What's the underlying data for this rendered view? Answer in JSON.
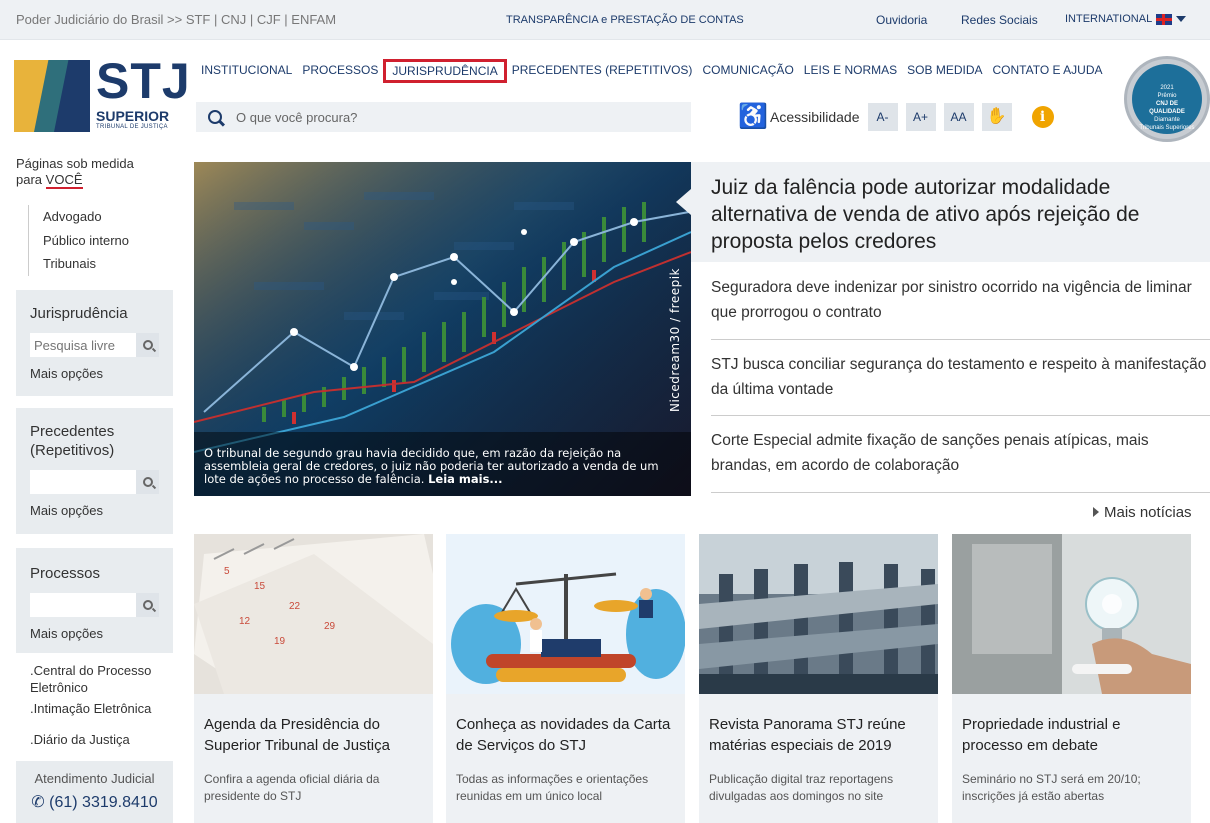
{
  "topbar": {
    "portal_links": "Poder Judiciário do Brasil >> STF | CNJ | CJF | ENFAM",
    "transparency": "TRANSPARÊNCIA e PRESTAÇÃO DE CONTAS",
    "ouvidoria": "Ouvidoria",
    "redes": "Redes Sociais",
    "international": "INTERNATIONAL"
  },
  "logo": {
    "stj": "STJ",
    "superior": "SUPERIOR",
    "tribunal": "TRIBUNAL DE JUSTIÇA"
  },
  "nav": [
    {
      "label": "INSTITUCIONAL"
    },
    {
      "label": "PROCESSOS"
    },
    {
      "label": "JURISPRUDÊNCIA",
      "active": true
    },
    {
      "label": "PRECEDENTES (REPETITIVOS)"
    },
    {
      "label": "COMUNICAÇÃO"
    },
    {
      "label": "LEIS E NORMAS"
    },
    {
      "label": "SOB MEDIDA"
    },
    {
      "label": "CONTATO E AJUDA"
    }
  ],
  "search": {
    "placeholder": "O que você procura?"
  },
  "accessibility": {
    "label": "Acessibilidade",
    "a_minus": "A-",
    "a_plus": "A+",
    "aa": "AA",
    "info": "i"
  },
  "seal": {
    "year": "2021",
    "line1": "Prêmio",
    "line2": "CNJ DE",
    "line3": "QUALIDADE",
    "line4": "Diamante",
    "line5": "Tribunais Superiores"
  },
  "sidebar": {
    "paginas_1": "Páginas sob medida",
    "paginas_2": "para",
    "voce": "VOCÊ",
    "profiles": [
      "Advogado",
      "Público interno",
      "Tribunais"
    ],
    "juris": {
      "title": "Jurisprudência",
      "placeholder": "Pesquisa livre",
      "more": "Mais opções"
    },
    "prec": {
      "title_1": "Precedentes",
      "title_2": "(Repetitivos)",
      "more": "Mais opções"
    },
    "proc": {
      "title": "Processos",
      "more": "Mais opções"
    },
    "links": [
      ".Central do Processo",
      "Eletrônico",
      ".Intimação Eletrônica",
      ".Diário da Justiça"
    ],
    "atendimento": {
      "title": "Atendimento Judicial",
      "phone": "(61) 3319.8410"
    }
  },
  "hero": {
    "caption": "O tribunal de segundo grau havia decidido que, em razão da rejeição na assembleia geral de credores, o juiz não poderia ter autorizado a venda de um lote de ações no processo de falência.",
    "read_more": "Leia mais...",
    "credit": "Nicedream30 / freepik"
  },
  "headline": "Juiz da falência pode autorizar modalidade alternativa de venda de ativo após rejeição de proposta pelos credores",
  "news": [
    "Seguradora deve indenizar por sinistro ocorrido na vigência de liminar que prorrogou o contrato",
    "STJ busca conciliar segurança do testamento e respeito à manifestação da última vontade",
    "Corte Especial admite fixação de sanções penais atípicas, mais brandas, em acordo de colaboração"
  ],
  "mais_noticias": "Mais notícias",
  "cards": [
    {
      "title": "Agenda da Presidência do Superior Tribunal de Justiça",
      "desc": "Confira a agenda oficial diária da presidente do STJ"
    },
    {
      "title": "Conheça as novidades da Carta de Serviços do STJ",
      "desc": "Todas as informações e orientações reunidas em um único local"
    },
    {
      "title": "Revista Panorama STJ reúne matérias especiais de 2019",
      "desc": "Publicação digital traz reportagens divulgadas aos domingos no site"
    },
    {
      "title": "Propriedade industrial e processo em debate",
      "desc": "Seminário no STJ será em 20/10; inscrições já estão abertas"
    }
  ]
}
